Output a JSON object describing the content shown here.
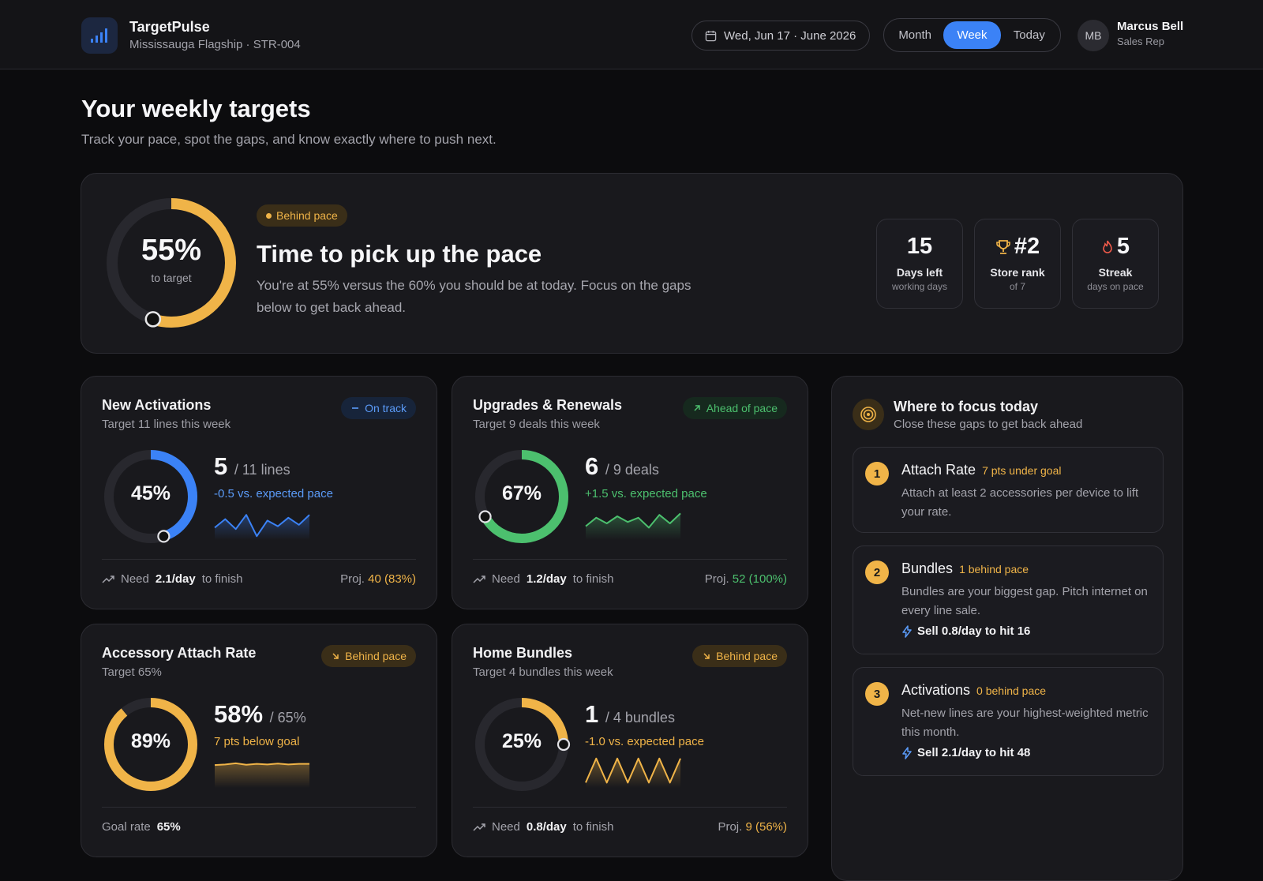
{
  "app": {
    "name": "TargetPulse",
    "store": "Mississauga Flagship · STR-004"
  },
  "header": {
    "date": "Wed, Jun 17 · June 2026",
    "tabs": [
      "Month",
      "Week",
      "Today"
    ],
    "active_tab": "Week",
    "user": {
      "initials": "MB",
      "name": "Marcus Bell",
      "role": "Sales Rep"
    }
  },
  "page": {
    "title": "Your weekly targets",
    "subtitle": "Track your pace, spot the gaps, and know exactly where to push next."
  },
  "hero": {
    "percent": "55%",
    "percent_value": 55,
    "caption": "to target",
    "status": "Behind pace",
    "headline": "Time to pick up the pace",
    "description": "You're at 55% versus the 60% you should be at today. Focus on the gaps below to get back ahead.",
    "stats": [
      {
        "value": "15",
        "label": "Days left",
        "sub": "working days",
        "icon": ""
      },
      {
        "value": "#2",
        "label": "Store rank",
        "sub": "of 7",
        "icon": "trophy-icon"
      },
      {
        "value": "5",
        "label": "Streak",
        "sub": "days on pace",
        "icon": "flame-icon"
      }
    ]
  },
  "metrics": [
    {
      "title": "New Activations",
      "target": "Target 11 lines this week",
      "badge": "On track",
      "badge_style": "blue",
      "badge_icon": "dash-icon",
      "percent": "45%",
      "percent_value": 45,
      "ring_color": "#3b82f6",
      "value": "5",
      "unit": "/ 11 lines",
      "delta": "-0.5 vs. expected pace",
      "delta_color": "#5b9bf8",
      "spark": [
        0.35,
        0.65,
        0.3,
        0.8,
        0.05,
        0.6,
        0.4,
        0.7,
        0.45,
        0.8
      ],
      "foot_left_prefix": "Need",
      "foot_left_value": "2.1/day",
      "foot_left_suffix": "to finish",
      "foot_right_prefix": "Proj.",
      "foot_right_value": "40 (83%)",
      "foot_right_color": "#f0b448"
    },
    {
      "title": "Upgrades & Renewals",
      "target": "Target 9 deals this week",
      "badge": "Ahead of pace",
      "badge_style": "green",
      "badge_icon": "arrow-up-right-icon",
      "percent": "67%",
      "percent_value": 67,
      "ring_color": "#4cc06e",
      "value": "6",
      "unit": "/ 9 deals",
      "delta": "+1.5 vs. expected pace",
      "delta_color": "#4cc06e",
      "spark": [
        0.4,
        0.7,
        0.5,
        0.75,
        0.55,
        0.7,
        0.35,
        0.8,
        0.5,
        0.85
      ],
      "foot_left_prefix": "Need",
      "foot_left_value": "1.2/day",
      "foot_left_suffix": "to finish",
      "foot_right_prefix": "Proj.",
      "foot_right_value": "52 (100%)",
      "foot_right_color": "#4cc06e"
    },
    {
      "title": "Accessory Attach Rate",
      "target": "Target 65%",
      "badge": "Behind pace",
      "badge_style": "amber",
      "badge_icon": "arrow-down-right-icon",
      "percent": "89%",
      "percent_value": 89,
      "ring_color": "#f0b448",
      "value": "58%",
      "unit": "/ 65%",
      "delta": "7 pts below goal",
      "delta_color": "#f0b448",
      "spark": [
        0.72,
        0.74,
        0.78,
        0.73,
        0.76,
        0.74,
        0.77,
        0.74,
        0.76,
        0.76
      ],
      "foot_left_prefix": "Goal rate",
      "foot_left_value": "65%",
      "foot_left_suffix": "",
      "foot_right_prefix": "",
      "foot_right_value": "",
      "foot_right_color": "#f0b448"
    },
    {
      "title": "Home Bundles",
      "target": "Target 4 bundles this week",
      "badge": "Behind pace",
      "badge_style": "amber",
      "badge_icon": "arrow-down-right-icon",
      "percent": "25%",
      "percent_value": 25,
      "ring_color": "#f0b448",
      "value": "1",
      "unit": "/ 4 bundles",
      "delta": "-1.0 vs. expected pace",
      "delta_color": "#f0b448",
      "spark": [
        0.1,
        0.95,
        0.1,
        0.95,
        0.1,
        0.95,
        0.1,
        0.95,
        0.1,
        0.95
      ],
      "foot_left_prefix": "Need",
      "foot_left_value": "0.8/day",
      "foot_left_suffix": "to finish",
      "foot_right_prefix": "Proj.",
      "foot_right_value": "9 (56%)",
      "foot_right_color": "#f0b448"
    }
  ],
  "focus": {
    "title": "Where to focus today",
    "subtitle": "Close these gaps to get back ahead",
    "items": [
      {
        "num": "1",
        "title": "Attach Rate",
        "tag": "7 pts under goal",
        "desc": "Attach at least 2 accessories per device to lift your rate.",
        "action": ""
      },
      {
        "num": "2",
        "title": "Bundles",
        "tag": "1 behind pace",
        "desc": "Bundles are your biggest gap. Pitch internet on every line sale.",
        "action": "Sell 0.8/day to hit 16"
      },
      {
        "num": "3",
        "title": "Activations",
        "tag": "0 behind pace",
        "desc": "Net-new lines are your highest-weighted metric this month.",
        "action": "Sell 2.1/day to hit 48"
      }
    ]
  },
  "colors": {
    "accent": "#3b82f6",
    "amber": "#f0b448",
    "green": "#4cc06e",
    "background": "#0c0c0e"
  }
}
